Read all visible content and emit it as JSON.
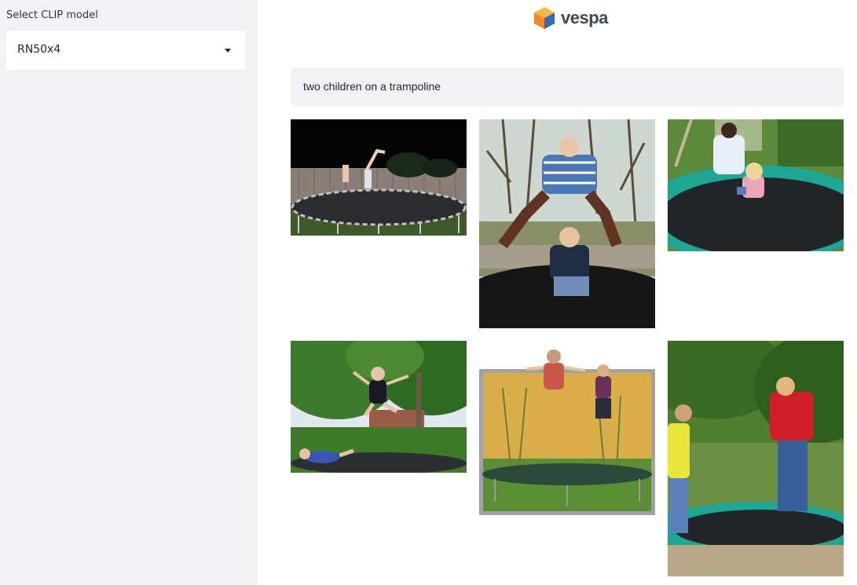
{
  "sidebar": {
    "label": "Select CLIP model",
    "selected_model": "RN50x4"
  },
  "header": {
    "logo_text": "vespa"
  },
  "search": {
    "query": "two children on a trampoline"
  },
  "results": [
    {
      "description": "night trampoline handstand"
    },
    {
      "description": "boys jumping on trampoline"
    },
    {
      "description": "children on green trampoline"
    },
    {
      "description": "girl jumping and boy flying over trampoline"
    },
    {
      "description": "two kids jumping against yellow wall"
    },
    {
      "description": "boys on green trampoline outdoors"
    }
  ],
  "colors": {
    "sidebar_bg": "#f0f2f6",
    "trampoline_green": "#1fa594",
    "vespa_orange": "#f29a32",
    "vespa_blue": "#2f6db5"
  }
}
